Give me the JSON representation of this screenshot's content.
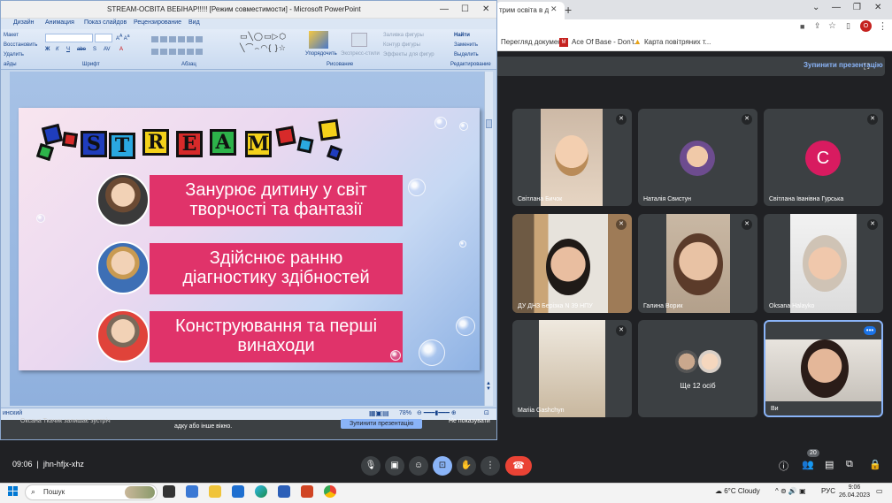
{
  "chrome": {
    "tab_title": "трим освіта в д",
    "bookmarks": [
      "Перегляд докумен...",
      "Ace Of Base - Don't...",
      "Карта повітряних т..."
    ],
    "present_stop": "Зупинити презентацію"
  },
  "participants": [
    {
      "name": "Світлана Бичок"
    },
    {
      "name": "Наталія Свистун"
    },
    {
      "name": "Світлана Іванівна Гурська",
      "initial": "С"
    },
    {
      "name": "ДУ ДНЗ Берізка N 39 НПУ"
    },
    {
      "name": "Галина Ворик"
    },
    {
      "name": "Oksana Halayko"
    },
    {
      "name": "Mariia Gashchyn"
    },
    {
      "name": "Ще 12 осіб"
    },
    {
      "name": "Ви"
    }
  ],
  "meet_bar": {
    "time": "09:06",
    "code": "jhn-hfjx-xhz",
    "people_count": "20"
  },
  "ppt": {
    "title": "STREAM-ОСВІТА ВЕБІНАР!!!!! [Режим совместимости] - Microsoft PowerPoint",
    "tabs": [
      "Дизайн",
      "Анимация",
      "Показ слайдов",
      "Рецензирование",
      "Вид"
    ],
    "ribbon_left": [
      "Макет",
      "Восстановить",
      "Удалить"
    ],
    "group_labels": [
      "айды",
      "Шрифт",
      "Абзац",
      "Рисование",
      "Редактирование"
    ],
    "drawing": [
      "Упорядочить",
      "Экспресс-стили",
      "Заливка фигуры",
      "Контур фигуры",
      "Эффекты для фигур"
    ],
    "editing": [
      "Найти",
      "Заменить",
      "Выделить"
    ],
    "zoom": "78%",
    "status_lang": "инский",
    "below_text_1": "Оксана Ткачик залишає зустріч",
    "below_text_2": "адку або інше вікно.",
    "below_btn": "Зупинити презентацію",
    "below_right": "Не показувати"
  },
  "slide": {
    "letters": [
      "S",
      "T",
      "R",
      "E",
      "A",
      "M"
    ],
    "letter_colors": [
      "#1f3dbd",
      "#2aa8e0",
      "#f4d11a",
      "#d72a2a",
      "#2db34a",
      "#f4d11a"
    ],
    "items": [
      {
        "line1": "Занурює дитину у світ",
        "line2": "творчості та фантазії"
      },
      {
        "line1": "Здійснює ранню",
        "line2": "діагностику здібностей"
      },
      {
        "line1": "Конструювання та перші",
        "line2": "винаходи"
      }
    ]
  },
  "taskbar": {
    "search": "Пошук",
    "weather": "6°C  Cloudy",
    "lang": "РУС",
    "time": "9:06",
    "date": "26.04.2023"
  }
}
